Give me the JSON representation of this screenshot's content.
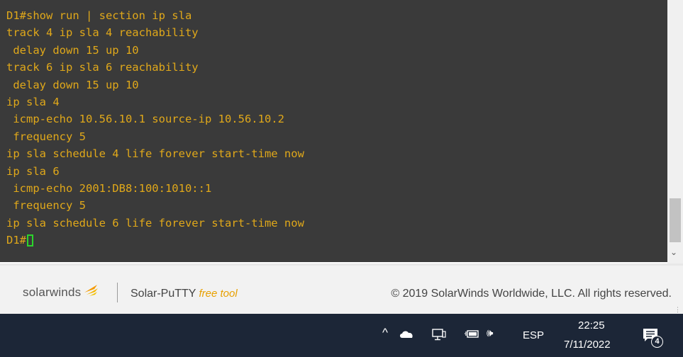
{
  "terminal": {
    "lines": [
      "D1#show run | section ip sla",
      "track 4 ip sla 4 reachability",
      " delay down 15 up 10",
      "track 6 ip sla 6 reachability",
      " delay down 15 up 10",
      "ip sla 4",
      " icmp-echo 10.56.10.1 source-ip 10.56.10.2",
      " frequency 5",
      "ip sla schedule 4 life forever start-time now",
      "ip sla 6",
      " icmp-echo 2001:DB8:100:1010::1",
      " frequency 5",
      "ip sla schedule 6 life forever start-time now"
    ],
    "prompt": "D1#",
    "text_color": "#e0a81a",
    "cursor_color": "#2cd52c"
  },
  "footer": {
    "logo_text": "solarwinds",
    "product": "Solar-PuTTY",
    "product_tag": "free tool",
    "copyright": "© 2019 SolarWinds Worldwide, LLC. All rights reserved."
  },
  "taskbar": {
    "chevron": "^",
    "language": "ESP",
    "time": "22:25",
    "date": "7/11/2022",
    "notification_count": "4",
    "tray_icons": [
      "chevron-up-icon",
      "onedrive-cloud-icon",
      "network-icon",
      "battery-icon",
      "volume-icon"
    ],
    "volume_glyph": "🕪"
  }
}
